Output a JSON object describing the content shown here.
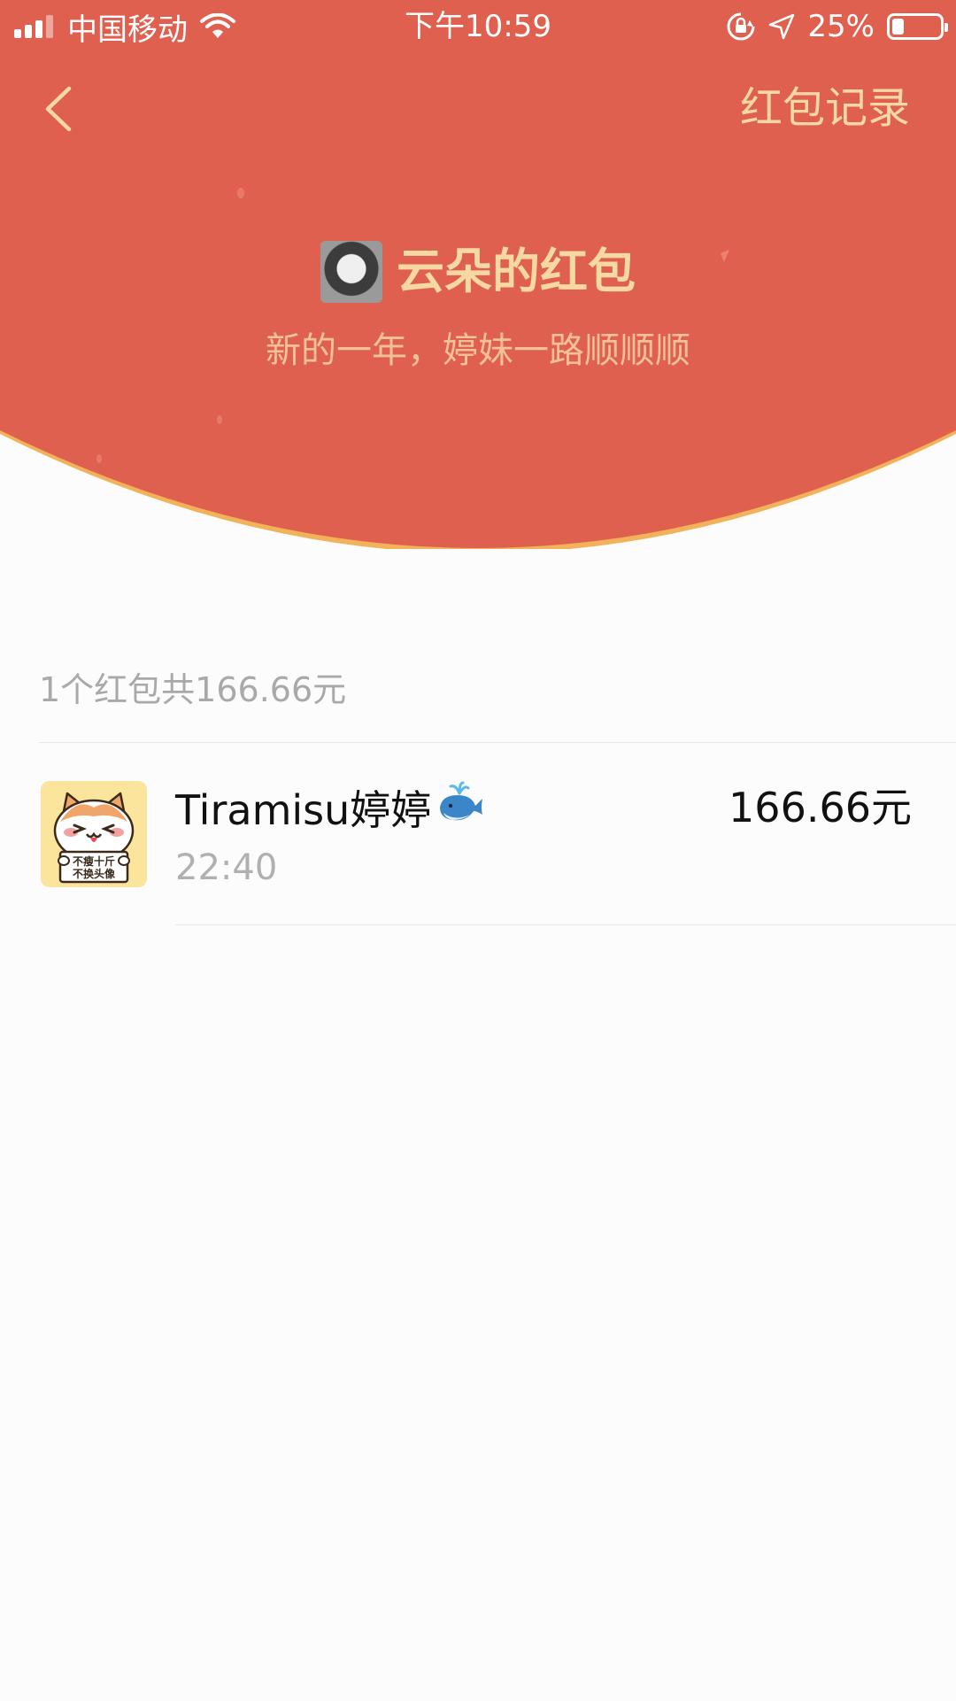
{
  "colors": {
    "header_red": "#e06050",
    "gold_text": "#f6d8a2",
    "curve_edge": "#f2b25a",
    "page_bg": "#fcfcfc"
  },
  "status_bar": {
    "carrier": "中国移动",
    "time": "下午10:59",
    "battery_percent": "25%",
    "battery_level": 0.25,
    "signal_bars": 3,
    "icons": [
      "signal-icon",
      "wifi-icon",
      "rotation-lock-icon",
      "location-arrow-icon",
      "battery-icon"
    ]
  },
  "nav": {
    "back_icon": "chevron-left-icon",
    "right_link": "红包记录"
  },
  "sender": {
    "title": "云朵的红包",
    "blessing": "新的一年，婷妹一路顺顺顺"
  },
  "summary": "1个红包共166.66元",
  "records": [
    {
      "name": "Tiramisu婷婷",
      "emoji": "🐳",
      "time": "22:40",
      "amount": "166.66元",
      "avatar_caption": [
        "不瘦十斤",
        "不换头像"
      ]
    }
  ]
}
